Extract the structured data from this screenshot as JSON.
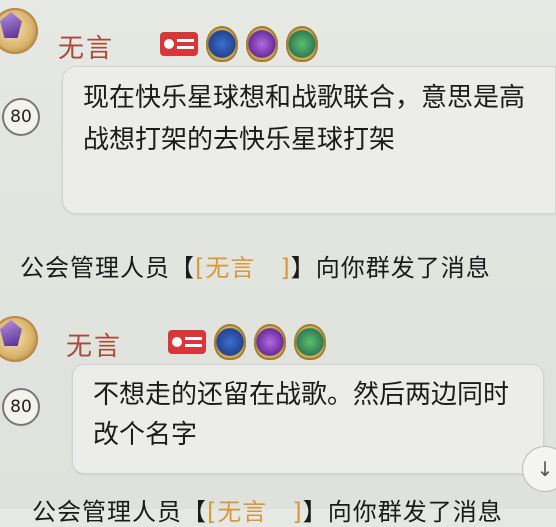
{
  "messages": [
    {
      "sender": "无言",
      "level": "80",
      "text": "现在快乐星球想和战歌联合，意思是高战想打架的去快乐星球打架",
      "badges": [
        "id-card-icon",
        "blue-medal-icon",
        "purple-medal-icon",
        "green-medal-icon"
      ]
    },
    {
      "sender": "无言",
      "level": "80",
      "text": "不想走的还留在战歌。然后两边同时改个名字",
      "badges": [
        "id-card-icon",
        "blue-medal-icon",
        "purple-medal-icon",
        "green-medal-icon"
      ]
    }
  ],
  "notices": [
    {
      "prefix": "公会管理人员【",
      "name": "[无言　]",
      "suffix": "】向你群发了消息"
    },
    {
      "prefix": "公会管理人员【",
      "name": "[无言　]",
      "suffix": "】向你群发了消息"
    }
  ],
  "colors": {
    "sender_name": "#a84a37",
    "notice_highlight": "#d8983a",
    "id_badge": "#d9363a"
  },
  "icons": {
    "scroll_down": "↓"
  }
}
